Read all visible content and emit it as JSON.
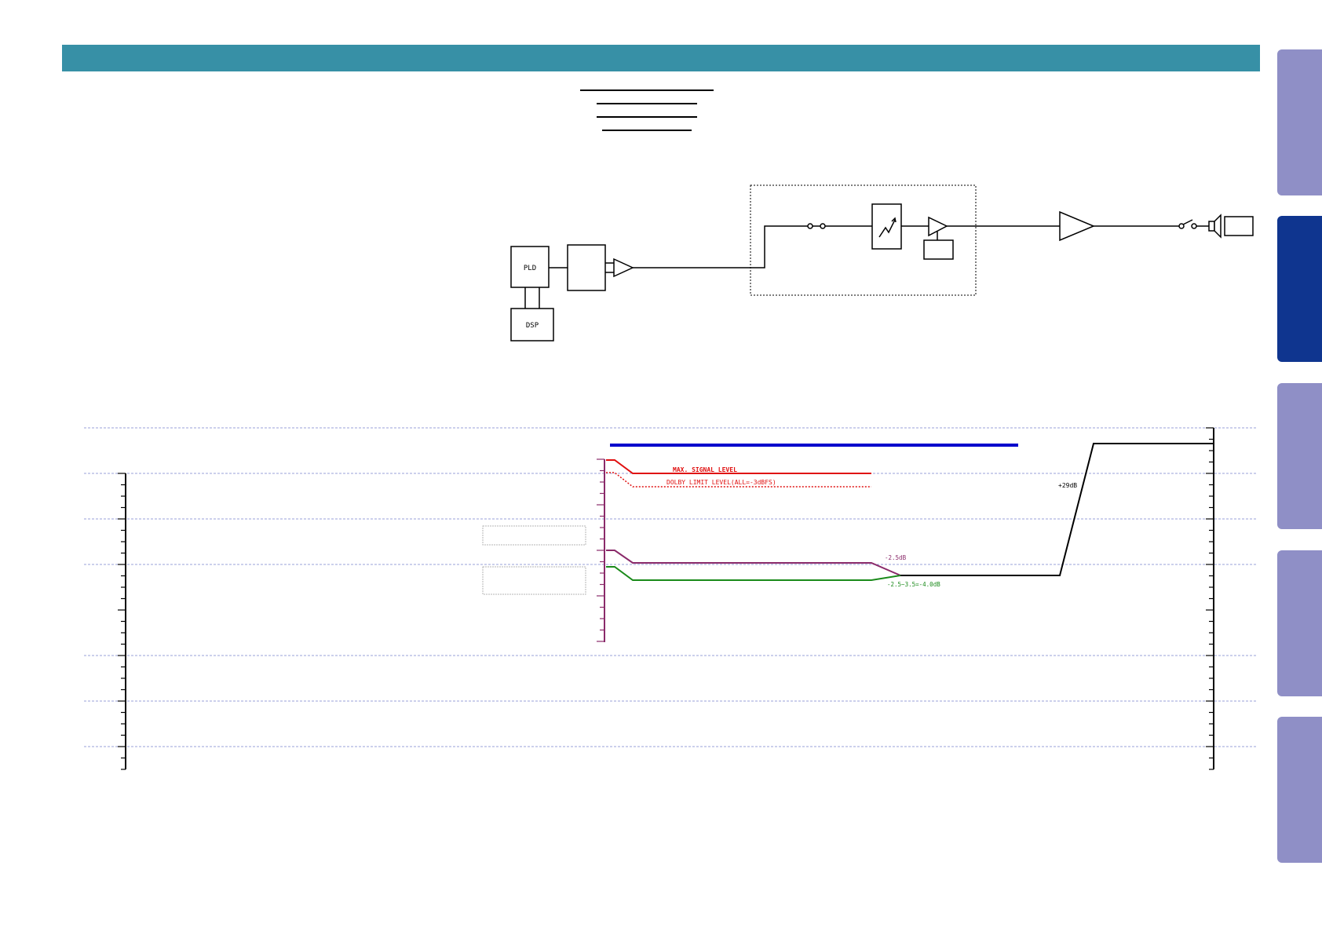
{
  "side_tabs": [
    {
      "label": "",
      "active": false
    },
    {
      "label": "",
      "active": true
    },
    {
      "label": "",
      "active": false
    },
    {
      "label": "",
      "active": false
    },
    {
      "label": "",
      "active": false
    }
  ],
  "block_diagram": {
    "pld_label": "PLD",
    "dsp_label": "DSP"
  },
  "level_diagram": {
    "max_signal_label": "MAX. SIGNAL LEVEL",
    "dolby_limit_label": "DOLBY LIMIT LEVEL(ALL=-3dBFS)",
    "annotation_purple": "-2.5dB",
    "annotation_green": "-2.5~3.5=-4.0dB",
    "annotation_gain": "+29dB"
  },
  "colors": {
    "header": "#3790a6",
    "tab_inactive": "#8f8fc6",
    "tab_active": "#0f358f",
    "max_level": "#e01010",
    "purple_trace": "#8a2a6a",
    "green_trace": "#1a8a1a",
    "blue_bar": "#0000cc",
    "grid": "#9aa0d8"
  }
}
